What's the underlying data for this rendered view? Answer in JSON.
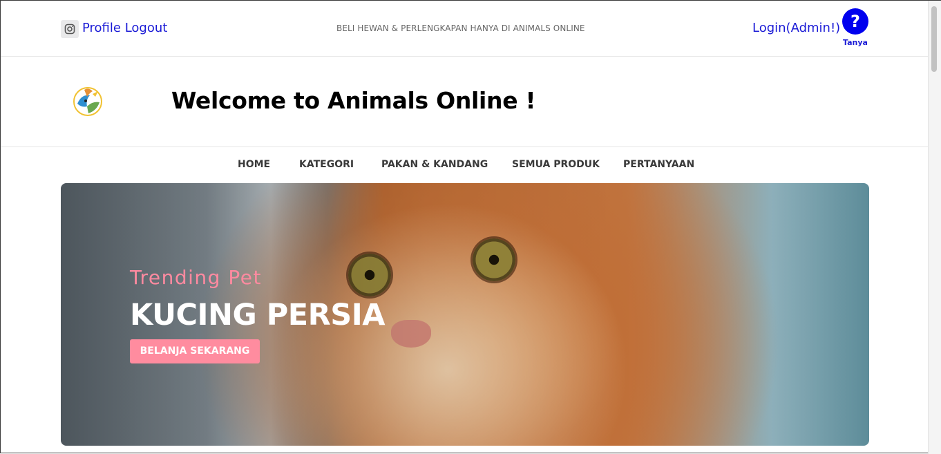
{
  "topbar": {
    "profile_label": "Profile",
    "logout_label": "Logout",
    "tagline": "BELI HEWAN & PERLENGKAPAN HANYA DI ANIMALS ONLINE",
    "login_label": "Login(Admin!)",
    "help_symbol": "?",
    "help_label": "Tanya"
  },
  "header": {
    "welcome": "Welcome to Animals Online !"
  },
  "nav": {
    "items": [
      {
        "label": "HOME"
      },
      {
        "label": "KATEGORI"
      },
      {
        "label": "PAKAN & KANDANG"
      },
      {
        "label": "SEMUA PRODUK"
      },
      {
        "label": "PERTANYAAN"
      }
    ]
  },
  "hero": {
    "eyebrow": "Trending Pet",
    "title": "KUCING PERSIA",
    "button_label": "BELANJA SEKARANG"
  },
  "colors": {
    "link": "#1a1ad6",
    "help_bg": "#0000ee",
    "accent_pink": "#ff8c9f"
  },
  "icons": [
    "instagram-icon",
    "help-icon",
    "brand-logo"
  ]
}
